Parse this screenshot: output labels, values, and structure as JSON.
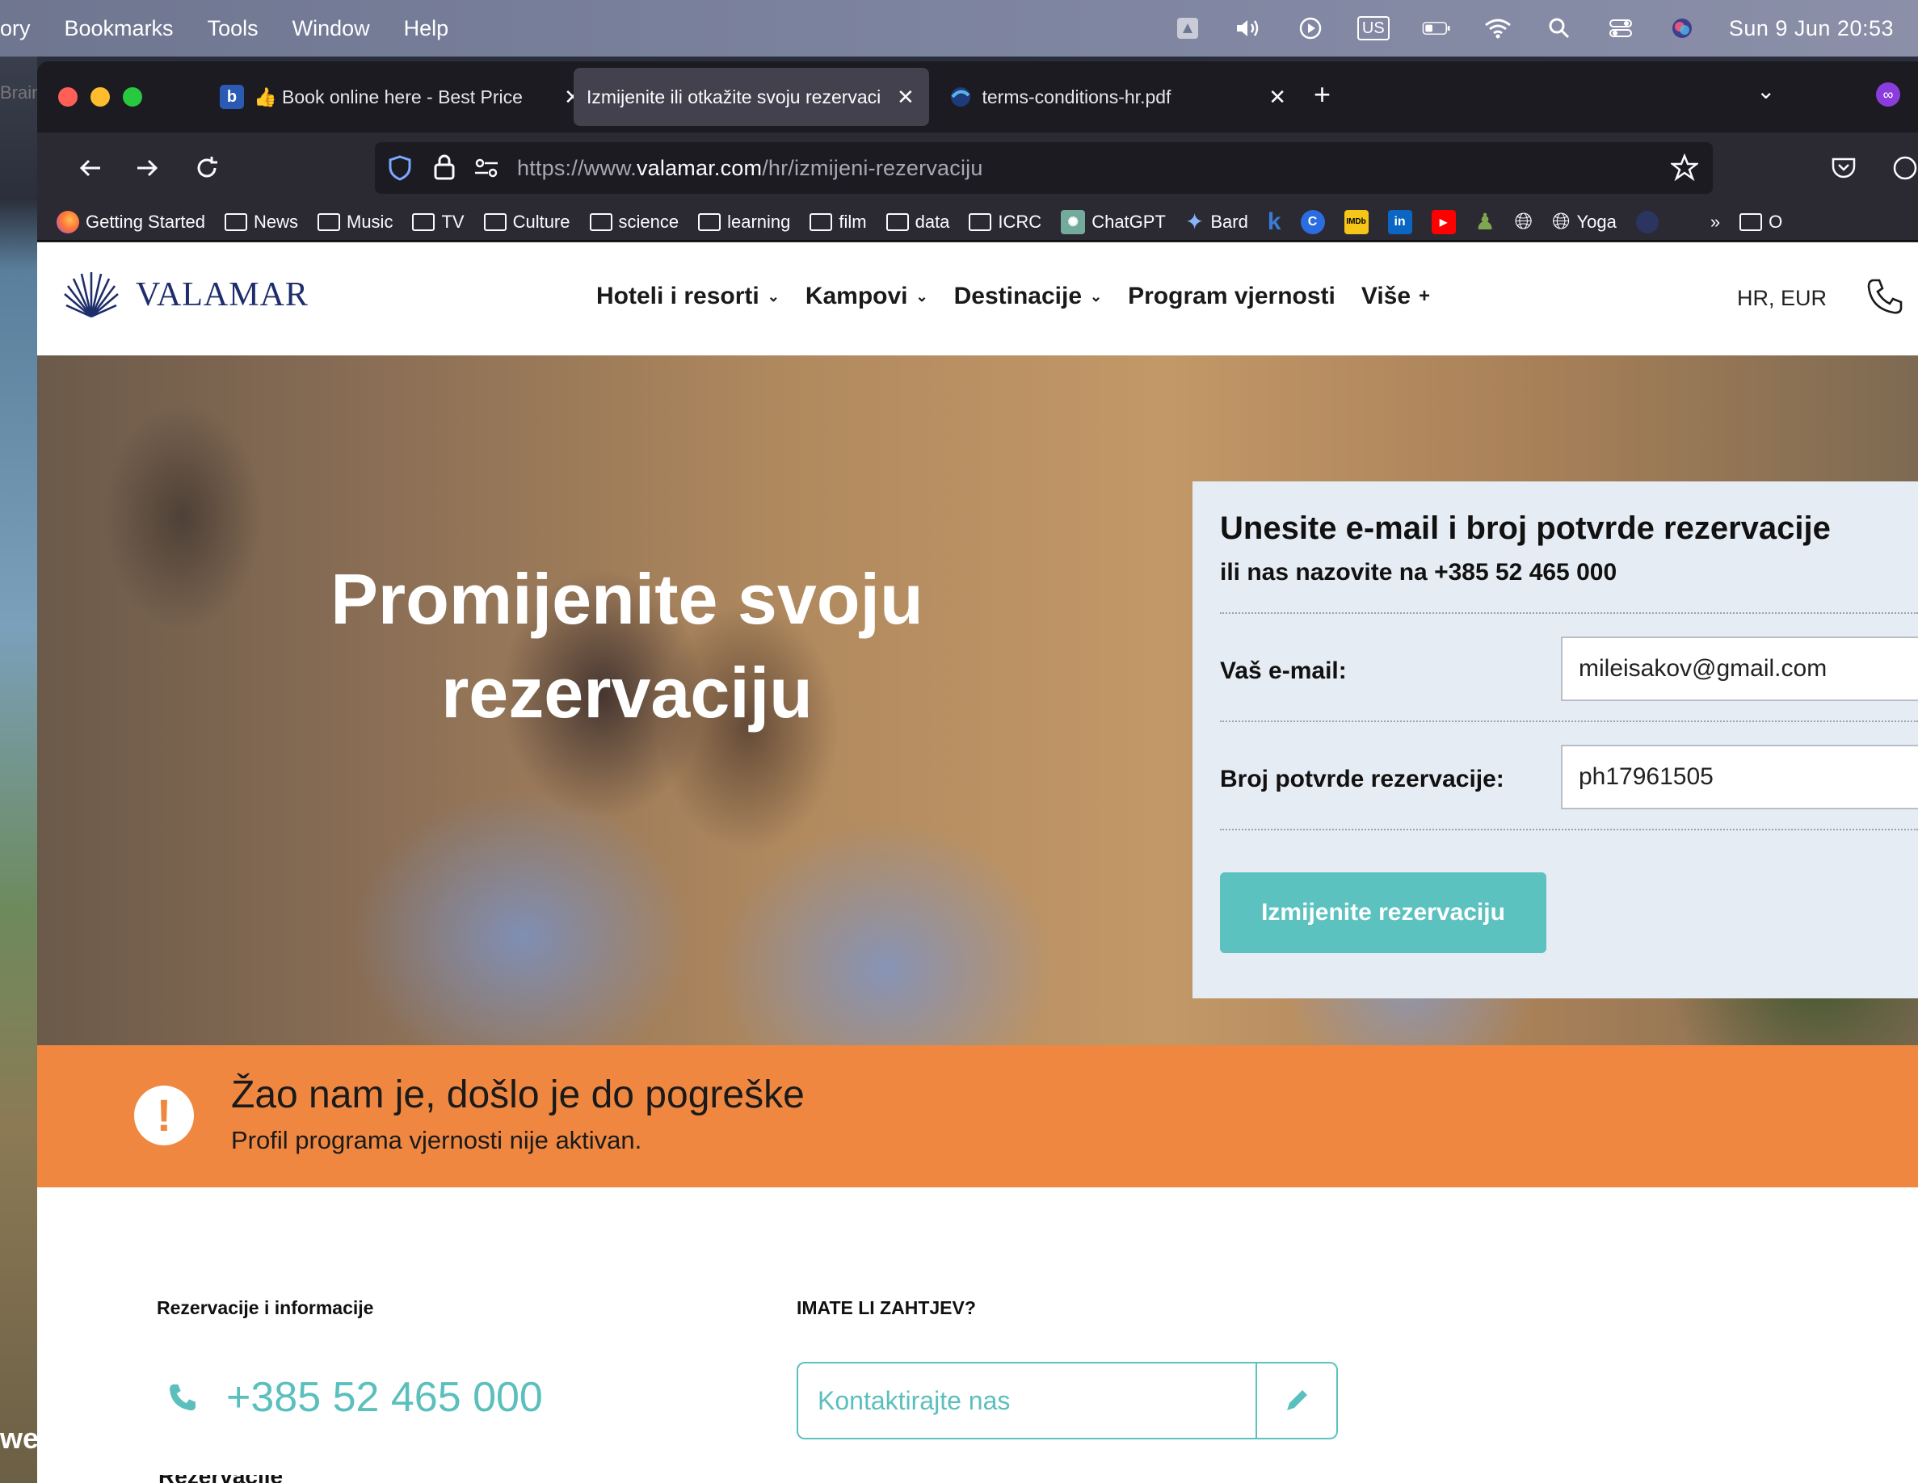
{
  "menubar": {
    "items": [
      "ory",
      "Bookmarks",
      "Tools",
      "Window",
      "Help"
    ],
    "input_source": "US",
    "clock": "Sun 9 Jun  20:53"
  },
  "desktop": {
    "edge_text": "we"
  },
  "tabs": [
    {
      "title": "Book online here - Best Price",
      "favicon": "b",
      "prefix": "👍"
    },
    {
      "title": "Izmijenite ili otkažite svoju rezervaci",
      "active": true
    },
    {
      "title": "terms-conditions-hr.pdf"
    }
  ],
  "background_tab_stub": "Brain",
  "url": {
    "scheme": "https://www.",
    "host": "valamar.com",
    "path": "/hr/izmijeni-rezervaciju"
  },
  "bookmarks": [
    {
      "label": "Getting Started",
      "icon": "firefox-icon"
    },
    {
      "label": "News",
      "icon": "folder-icon"
    },
    {
      "label": "Music",
      "icon": "folder-icon"
    },
    {
      "label": "TV",
      "icon": "folder-icon"
    },
    {
      "label": "Culture",
      "icon": "folder-icon"
    },
    {
      "label": "science",
      "icon": "folder-icon"
    },
    {
      "label": "learning",
      "icon": "folder-icon"
    },
    {
      "label": "film",
      "icon": "folder-icon"
    },
    {
      "label": "data",
      "icon": "folder-icon"
    },
    {
      "label": "ICRC",
      "icon": "folder-icon"
    },
    {
      "label": "ChatGPT",
      "icon": "chatgpt-icon"
    },
    {
      "label": "Bard",
      "icon": "bard-icon"
    },
    {
      "label": "Yoga",
      "icon": "globe-icon"
    }
  ],
  "bookmarks_overflow": "O",
  "site": {
    "brand": "VALAMAR",
    "nav": [
      {
        "label": "Hoteli i resorti",
        "marker": "⌄"
      },
      {
        "label": "Kampovi",
        "marker": "⌄"
      },
      {
        "label": "Destinacije",
        "marker": "⌄"
      },
      {
        "label": "Program vjernosti",
        "marker": ""
      },
      {
        "label": "Više",
        "marker": "+"
      }
    ],
    "lang": "HR, EUR",
    "hero_title_line1": "Promijenite svoju",
    "hero_title_line2": "rezervaciju"
  },
  "form": {
    "title": "Unesite e-mail i broj potvrde rezervacije",
    "subtitle": "ili nas nazovite na +385 52 465 000",
    "email_label": "Vaš e-mail:",
    "email_value": "mileisakov@gmail.com",
    "confirmation_label": "Broj potvrde rezervacije:",
    "confirmation_value": "ph17961505",
    "submit_label": "Izmijenite rezervaciju"
  },
  "error": {
    "title": "Žao nam je, došlo je do pogreške",
    "message": "Profil programa vjernosti nije aktivan."
  },
  "footer": {
    "reservations_heading": "Rezervacije i informacije",
    "phone": "+385 52 465 000",
    "request_heading": "IMATE LI ZAHTJEV?",
    "contact_label": "Kontaktirajte nas"
  }
}
